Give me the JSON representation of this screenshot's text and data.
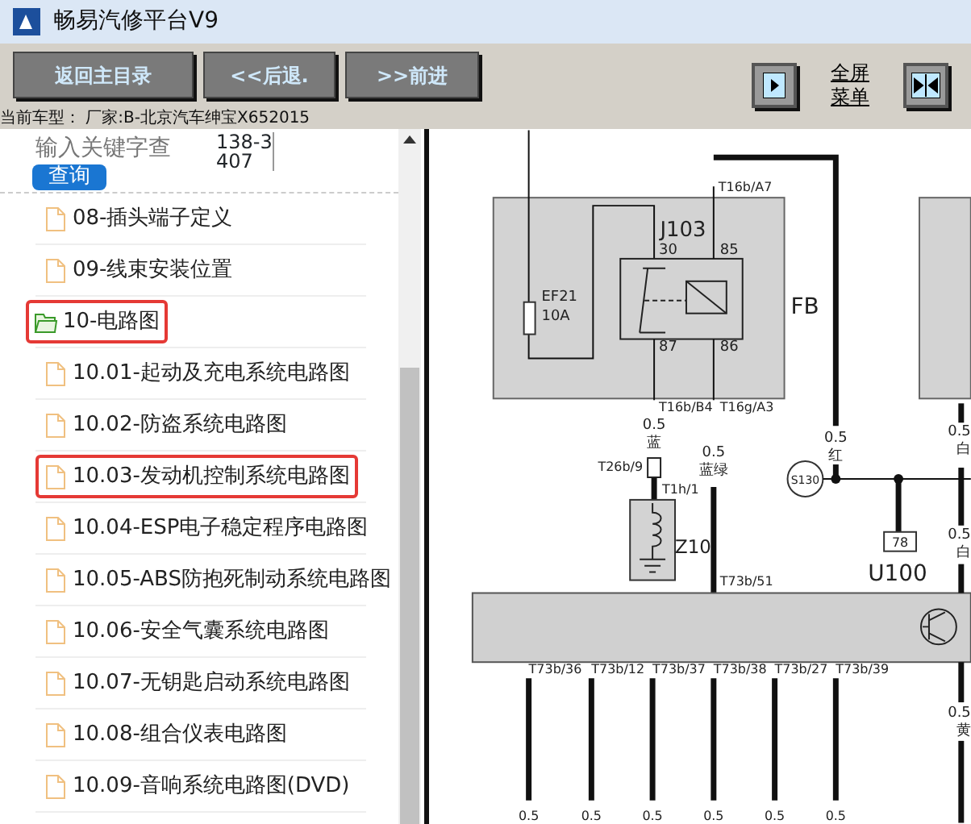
{
  "window": {
    "title": "畅易汽修平台V9"
  },
  "toolbar": {
    "buttons": [
      "返回主目录",
      "<<后退.",
      ">>前进"
    ],
    "fullscreen_link": "全屏菜单"
  },
  "vehicle_info": "当前车型： 厂家:B-北京汽车绅宝X652015",
  "search": {
    "placeholder": "输入关键字查",
    "side_text": "138-3407",
    "button": "查询"
  },
  "tree": [
    {
      "label": "08-插头端子定义",
      "kind": "file",
      "highlighted": false
    },
    {
      "label": "09-线束安装位置",
      "kind": "file",
      "highlighted": false
    },
    {
      "label": "10-电路图",
      "kind": "folder",
      "expanded": true,
      "highlighted": true,
      "children": [
        {
          "label": "10.01-起动及充电系统电路图",
          "kind": "file",
          "highlighted": false
        },
        {
          "label": "10.02-防盗系统电路图",
          "kind": "file",
          "highlighted": false
        },
        {
          "label": "10.03-发动机控制系统电路图",
          "kind": "file",
          "highlighted": true
        },
        {
          "label": "10.04-ESP电子稳定程序电路图",
          "kind": "file",
          "highlighted": false
        },
        {
          "label": "10.05-ABS防抱死制动系统电路图",
          "kind": "file",
          "highlighted": false
        },
        {
          "label": "10.06-安全气囊系统电路图",
          "kind": "file",
          "highlighted": false
        },
        {
          "label": "10.07-无钥匙启动系统电路图",
          "kind": "file",
          "highlighted": false
        },
        {
          "label": "10.08-组合仪表电路图",
          "kind": "file",
          "highlighted": false
        },
        {
          "label": "10.09-音响系统电路图(DVD)",
          "kind": "file",
          "highlighted": false
        }
      ]
    }
  ],
  "diagram": {
    "fuse_box": {
      "label": "FB",
      "relay": {
        "label": "J103",
        "pins": [
          "30",
          "85",
          "87",
          "86"
        ]
      },
      "fuse": {
        "label": "EF21",
        "rating": "10A"
      }
    },
    "connectors": [
      "T16b/A7",
      "T16b/B4",
      "T16g/A3",
      "T26b/9",
      "T1h/1",
      "T73b/51"
    ],
    "wires": [
      {
        "size": "0.5",
        "marking": "蓝"
      },
      {
        "size": "0.5",
        "marking": "蓝绿"
      },
      {
        "size": "0.5",
        "marking": "红"
      },
      {
        "size": "0.5",
        "marking": "白"
      },
      {
        "size": "0.5",
        "marking": "白"
      },
      {
        "size": "0.5",
        "marking": "黄"
      }
    ],
    "components": [
      "Z10",
      "S130",
      "78",
      "U100"
    ],
    "module_pins": [
      {
        "connector": "T73b/36",
        "size": "0.5"
      },
      {
        "connector": "T73b/12",
        "size": "0.5"
      },
      {
        "connector": "T73b/37",
        "size": "0.5"
      },
      {
        "connector": "T73b/38",
        "size": "0.5"
      },
      {
        "connector": "T73b/27",
        "size": "0.5"
      },
      {
        "connector": "T73b/39",
        "size": "0.5"
      }
    ]
  }
}
